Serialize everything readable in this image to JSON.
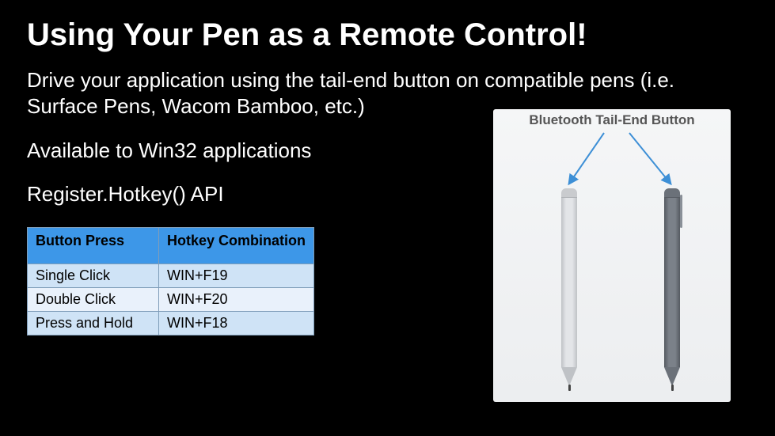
{
  "title": "Using Your Pen as a Remote Control!",
  "p1": "Drive your application using the tail-end button on compatible pens (i.e. Surface Pens, Wacom Bamboo, etc.)",
  "p2": "Available to Win32 applications",
  "p3": "Register.Hotkey() API",
  "table": {
    "headers": {
      "a": "Button Press",
      "b": "Hotkey Combination"
    },
    "rows": [
      {
        "press": "Single Click",
        "hotkey": "WIN+F19"
      },
      {
        "press": "Double Click",
        "hotkey": "WIN+F20"
      },
      {
        "press": "Press and Hold",
        "hotkey": "WIN+F18"
      }
    ]
  },
  "pen_panel": {
    "label": "Bluetooth Tail-End Button"
  }
}
